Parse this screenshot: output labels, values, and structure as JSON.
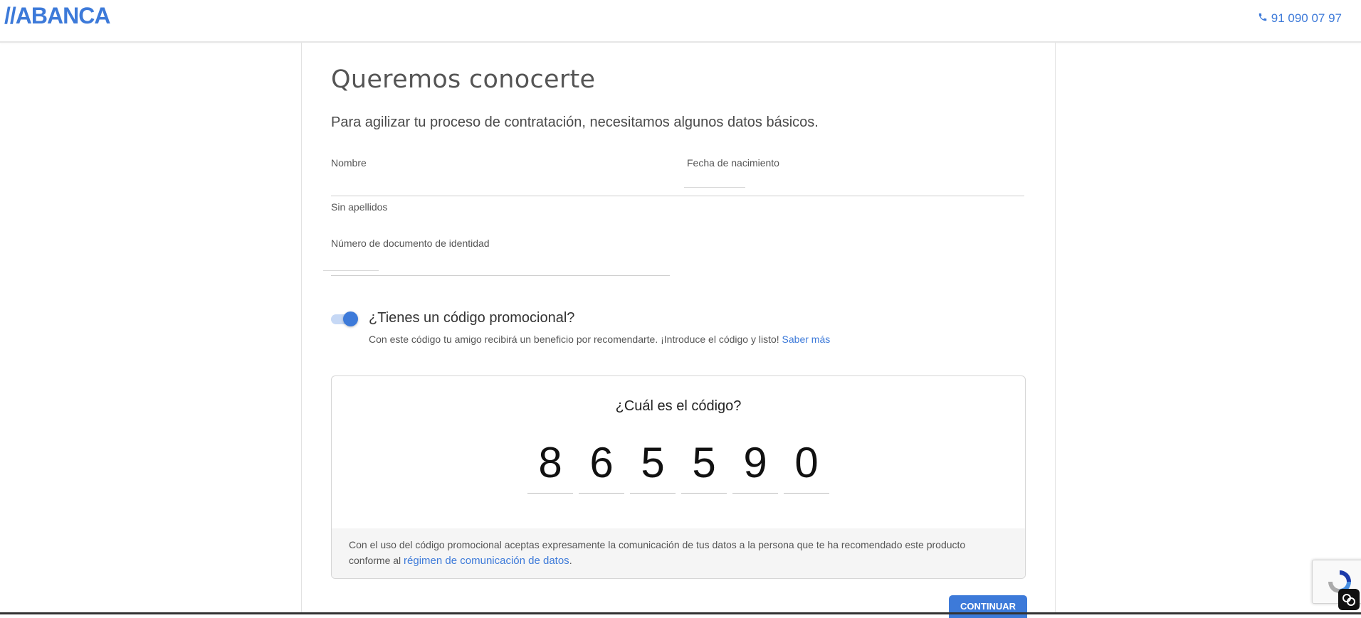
{
  "header": {
    "logo": "//ABANCA",
    "phone": "91 090 07 97"
  },
  "form": {
    "title": "Queremos conocerte",
    "subtitle": "Para agilizar tu proceso de contratación, necesitamos algunos datos básicos.",
    "nombre_label": "Nombre",
    "fecha_label": "Fecha de nacimiento",
    "sin_apellidos_label": "Sin apellidos",
    "documento_label": "Número de documento de identidad",
    "promo_toggle_on": true,
    "promo_question": "¿Tienes un código promocional?",
    "promo_description": "Con este código tu amigo recibirá un beneficio por recomendarte. ¡Introduce el código y listo!",
    "promo_link": "Saber más"
  },
  "code_card": {
    "title": "¿Cuál es el código?",
    "digits": [
      "8",
      "6",
      "5",
      "5",
      "9",
      "0"
    ],
    "footer_text": "Con el uso del código promocional aceptas expresamente la comunicación de tus datos a la persona que te ha recomendado este producto conforme al",
    "footer_link": "régimen de comunicación de datos",
    "footer_end": "."
  },
  "actions": {
    "continue_label": "CONTINUAR"
  },
  "colors": {
    "brand": "#3d7ad9"
  }
}
